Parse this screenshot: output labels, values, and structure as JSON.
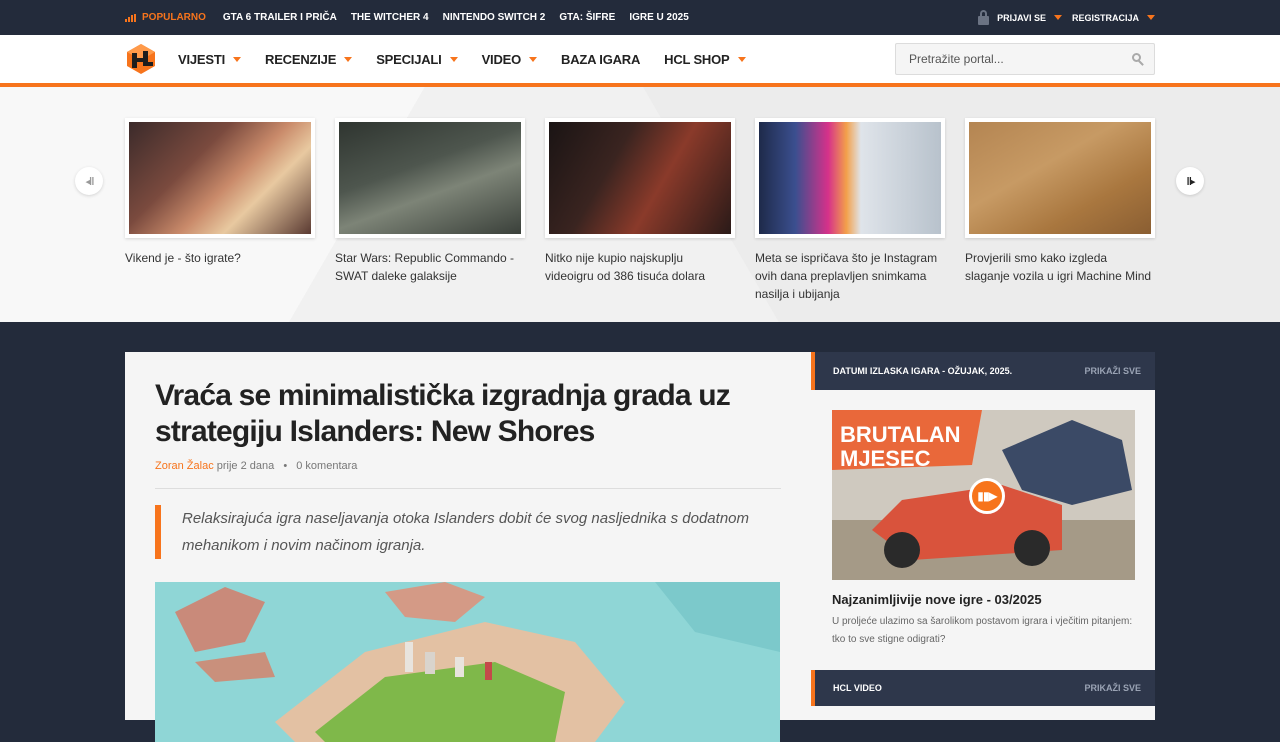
{
  "topbar": {
    "popular_label": "POPULARNO",
    "links": [
      "GTA 6 TRAILER I PRIČA",
      "THE WITCHER 4",
      "NINTENDO SWITCH 2",
      "GTA: ŠIFRE",
      "IGRE U 2025"
    ],
    "login": "PRIJAVI SE",
    "register": "REGISTRACIJA"
  },
  "nav": {
    "items": [
      "VIJESTI",
      "RECENZIJE",
      "SPECIJALI",
      "VIDEO",
      "BAZA IGARA",
      "HCL SHOP"
    ],
    "search_placeholder": "Pretražite portal..."
  },
  "slider": {
    "items": [
      {
        "caption": "Vikend je - što igrate?"
      },
      {
        "caption": "Star Wars: Republic Commando - SWAT daleke galaksije"
      },
      {
        "caption": "Nitko nije kupio najskuplju videoigru od 386 tisuća dolara"
      },
      {
        "caption": "Meta se ispričava što je Instagram ovih dana preplavljen snimkama nasilja i ubijanja"
      },
      {
        "caption": "Provjerili smo kako izgleda slaganje vozila u igri Machine Mind"
      }
    ]
  },
  "article": {
    "title": "Vraća se minimalistička izgradnja grada uz strategiju Islanders: New Shores",
    "author": "Zoran Žalac",
    "time": "prije 2 dana",
    "comments": "0 komentara",
    "lead": "Relaksirajuća igra naseljavanja otoka Islanders dobit će svog nasljednika s dodatnom mehanikom i novim načinom igranja."
  },
  "sidebar": {
    "section1_title": "DATUMI IZLASKA IGARA - OŽUJAK, 2025.",
    "section1_more": "PRIKAŽI SVE",
    "feature_overlay": [
      "BRUTALAN",
      "MJESEC"
    ],
    "feature_title": "Najzanimljivije nove igre - 03/2025",
    "feature_desc": "U proljeće ulazimo sa šarolikom postavom igrara i vječitim pitanjem: tko to sve stigne odigrati?",
    "section2_title": "HCL VIDEO",
    "section2_more": "PRIKAŽI SVE"
  },
  "colors": {
    "accent": "#f7741c",
    "dark": "#232b3b",
    "panel": "#2e374b"
  }
}
